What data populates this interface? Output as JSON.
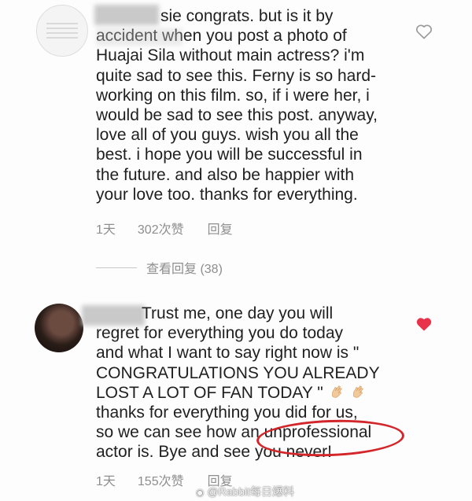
{
  "comment1": {
    "lines": [
      "sie congrats. but is it by",
      "accident when you post a photo of",
      "Huajai Sila without main actress? i'm",
      "quite sad to see this. Ferny is so hard-",
      "working on this film. so, if i were her, i",
      "would be sad to see this post. anyway,",
      "love all of you guys. wish you all the",
      "best. i hope you will be successful in",
      "the future. and also be happier with",
      "your love too. thanks for everything."
    ],
    "time": "1天",
    "likes": "302次赞",
    "reply": "回复",
    "liked": false
  },
  "view_replies": "查看回复 (38)",
  "comment2": {
    "lines": [
      "Trust me, one day you will",
      "regret for everything you do today",
      "and what I want to say right now is \"",
      "CONGRATULATIONS YOU ALREADY",
      "LOST A LOT OF FAN TODAY \"",
      "thanks for everything you did for us,",
      "so we can see how an unprofessional",
      "actor is. Bye and see you never!"
    ],
    "time": "1天",
    "likes": "155次赞",
    "reply": "回复",
    "liked": true,
    "highlighted_word": "unprofessional"
  },
  "watermark": "@Rabbit每日爆料",
  "colors": {
    "heart_liked": "#e8334a",
    "heart_outline": "#9a9a9a",
    "highlight_ellipse": "#d3262a",
    "meta_text": "#8e8e8e"
  },
  "icons": [
    "avatar",
    "heart-outline-icon",
    "heart-filled-icon",
    "clapping-hands-emoji",
    "weibo-icon"
  ]
}
